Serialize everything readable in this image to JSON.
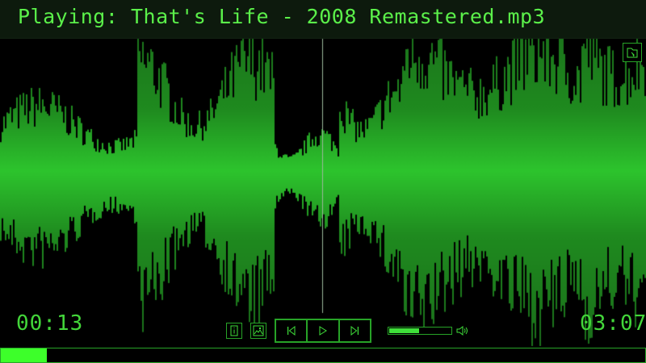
{
  "player": {
    "title": "Playing: That's Life - 2008 Remastered.mp3",
    "elapsed": "00:13",
    "total": "03:07",
    "progress_fraction": 0.072,
    "volume_fraction": 0.5,
    "playhead_fraction": 0.499
  },
  "icons": {
    "folder": "open-folder-icon",
    "info": "info-icon",
    "image": "image-icon",
    "previous": "skip-previous-icon",
    "play": "play-icon",
    "next": "skip-next-icon",
    "volume": "speaker-icon"
  },
  "colors": {
    "accent": "#3fe03a",
    "title": "#5bf04a",
    "border": "#27a327",
    "waveform_center": "#2dc42d",
    "waveform_edge": "#1a6b1a"
  }
}
